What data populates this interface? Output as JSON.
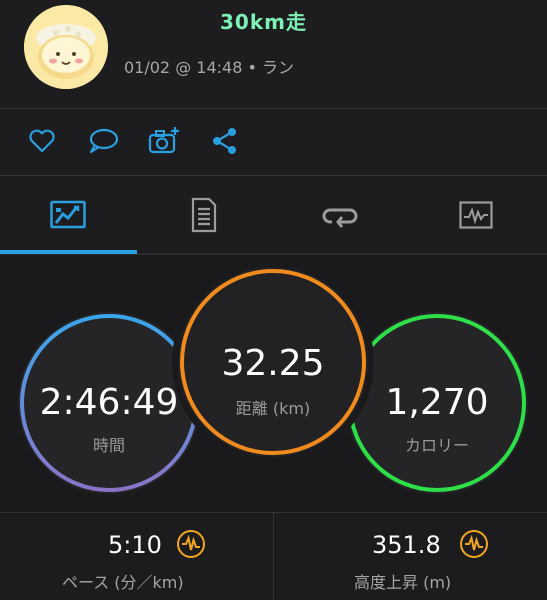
{
  "header": {
    "title": "30km走",
    "meta": "01/02 @ 14:48 • ラン"
  },
  "actions": [
    {
      "name": "like-button",
      "icon": "heart-icon"
    },
    {
      "name": "comment-button",
      "icon": "speech-bubble-icon"
    },
    {
      "name": "add-photo-button",
      "icon": "camera-plus-icon"
    },
    {
      "name": "share-button",
      "icon": "share-icon"
    }
  ],
  "tabs": [
    {
      "name": "tab-overview",
      "icon": "overview-icon",
      "active": true
    },
    {
      "name": "tab-details",
      "icon": "document-icon",
      "active": false
    },
    {
      "name": "tab-laps",
      "icon": "laps-icon",
      "active": false
    },
    {
      "name": "tab-charts",
      "icon": "chart-icon",
      "active": false
    }
  ],
  "stats": {
    "time": {
      "value": "2:46:49",
      "label": "時間"
    },
    "distance": {
      "value": "32.25",
      "label": "距離 (km)"
    },
    "calories": {
      "value": "1,270",
      "label": "カロリー"
    }
  },
  "bottom": {
    "pace": {
      "value": "5:10",
      "label": "ペース (分／km)",
      "icon": "activity-wave-icon"
    },
    "elevation": {
      "value": "351.8",
      "label": "高度上昇 (m)",
      "icon": "activity-wave-icon"
    }
  },
  "colors": {
    "accent_blue": "#2a9fe0",
    "title_green": "#7cf2b4",
    "ring_orange": "#f28b1d",
    "ring_green": "#2ee048",
    "icon_orange": "#f2a51b"
  }
}
